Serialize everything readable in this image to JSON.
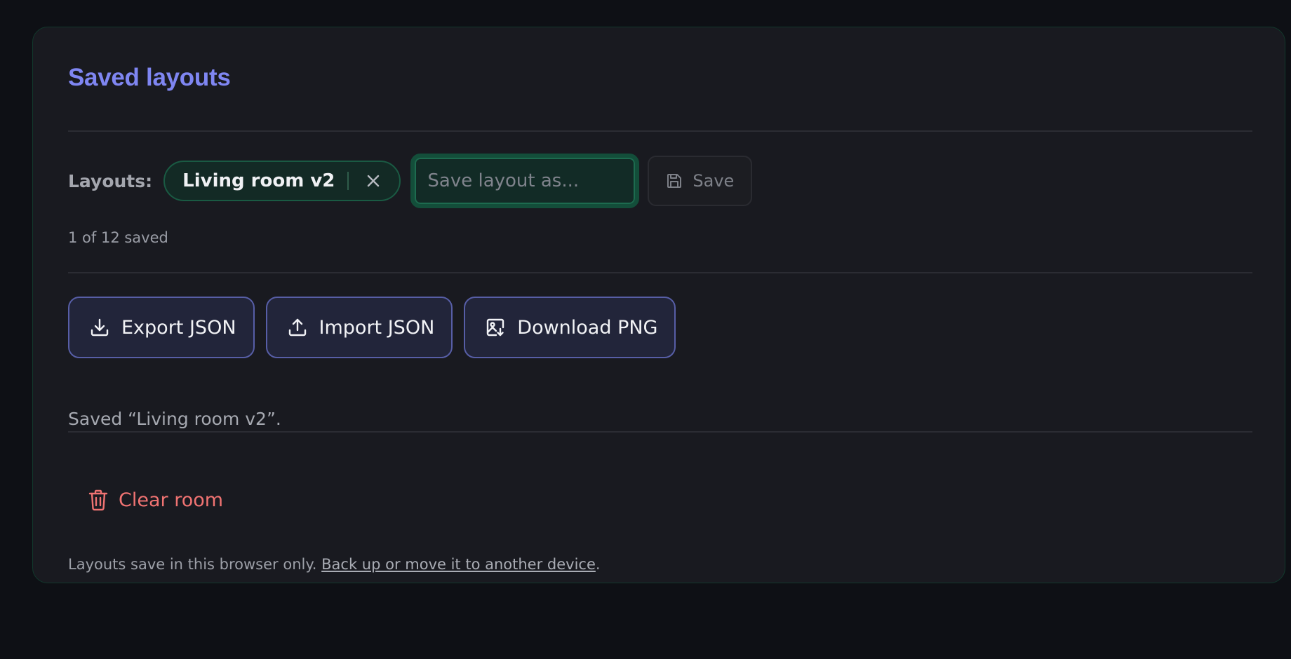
{
  "panel": {
    "title": "Saved layouts"
  },
  "layouts": {
    "label": "Layouts:",
    "chips": [
      {
        "label": "Living room v2"
      }
    ],
    "input_placeholder": "Save layout as...",
    "input_value": "",
    "save_label": "Save",
    "count_text": "1 of 12 saved"
  },
  "actions": {
    "export_label": "Export JSON",
    "import_label": "Import JSON",
    "download_label": "Download PNG"
  },
  "status": {
    "message": "Saved “Living room v2”."
  },
  "danger": {
    "clear_label": "Clear room"
  },
  "footer": {
    "text": "Layouts save in this browser only.",
    "link_label": "Back up or move it to another device",
    "suffix": "."
  },
  "colors": {
    "accent_title": "#7f86f2",
    "accent_green": "#1a5a43",
    "accent_indigo": "#575ea6",
    "danger": "#f07372"
  },
  "icons": {
    "chip_close": "close-icon",
    "save": "floppy-disk-icon",
    "export": "download-icon",
    "import": "upload-icon",
    "download_png": "image-download-icon",
    "clear": "trash-icon"
  }
}
